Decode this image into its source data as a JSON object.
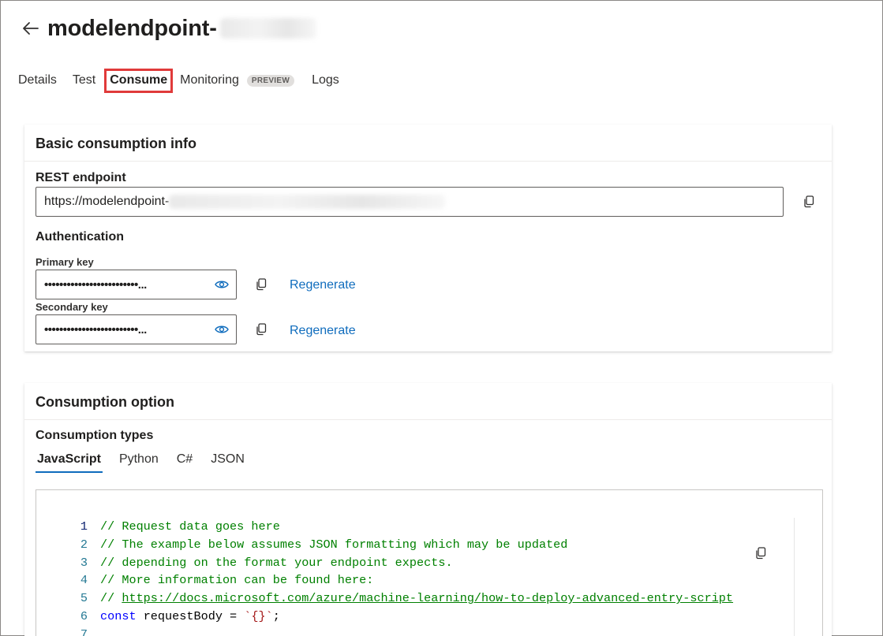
{
  "header": {
    "title_prefix": "modelendpoint-",
    "back_icon": "arrow-left-icon"
  },
  "tabs": [
    {
      "label": "Details"
    },
    {
      "label": "Test"
    },
    {
      "label": "Consume",
      "active": true
    },
    {
      "label": "Monitoring",
      "badge": "PREVIEW"
    },
    {
      "label": "Logs"
    }
  ],
  "basic_info": {
    "title": "Basic consumption info",
    "rest_endpoint_label": "REST endpoint",
    "rest_endpoint_value": "https://modelendpoint-",
    "authentication_label": "Authentication",
    "primary_key_label": "Primary key",
    "primary_key_value": "•••••••••••••••••••••••••...",
    "secondary_key_label": "Secondary key",
    "secondary_key_value": "•••••••••••••••••••••••••...",
    "regenerate_label": "Regenerate"
  },
  "consumption_option": {
    "title": "Consumption option",
    "types_label": "Consumption types",
    "types": [
      {
        "label": "JavaScript",
        "active": true
      },
      {
        "label": "Python"
      },
      {
        "label": "C#"
      },
      {
        "label": "JSON"
      }
    ],
    "code_lines": [
      {
        "num": "1",
        "comment": "// Request data goes here"
      },
      {
        "num": "2",
        "comment": "// The example below assumes JSON formatting which may be updated"
      },
      {
        "num": "3",
        "comment": "// depending on the format your endpoint expects."
      },
      {
        "num": "4",
        "comment": "// More information can be found here:"
      },
      {
        "num": "5",
        "comment_prefix": "// ",
        "url": "https://docs.microsoft.com/azure/machine-learning/how-to-deploy-advanced-entry-script"
      },
      {
        "num": "6",
        "keyword": "const",
        "ident": " requestBody = ",
        "string": "`{}`",
        "tail": ";"
      },
      {
        "num": "7"
      }
    ]
  },
  "colors": {
    "accent": "#0f6cbd",
    "highlight_box": "#e03a3a",
    "comment": "#008000"
  }
}
